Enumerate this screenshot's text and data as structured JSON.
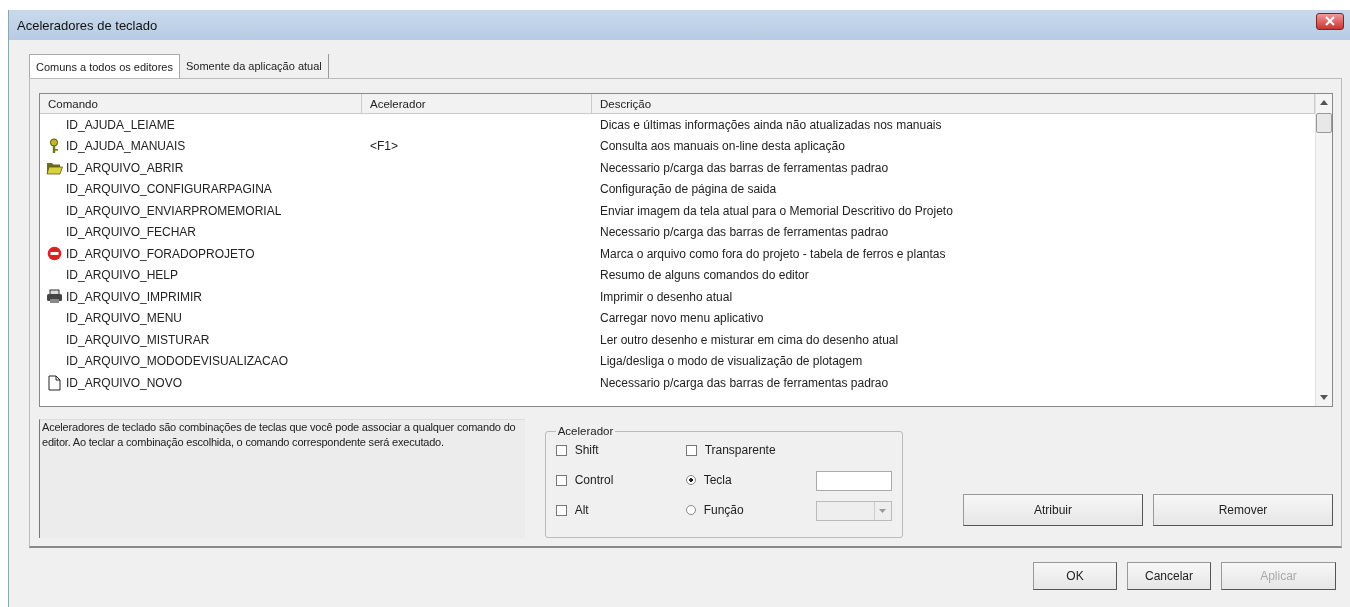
{
  "window": {
    "title": "Aceleradores de teclado"
  },
  "tabs": [
    {
      "label": "Comuns a todos os editores",
      "selected": true
    },
    {
      "label": "Somente da aplicação atual",
      "selected": false
    }
  ],
  "table": {
    "columns": [
      "Comando",
      "Acelerador",
      "Descrição"
    ],
    "rows": [
      {
        "kind": "none",
        "command": "ID_AJUDA_LEIAME",
        "accelerator": "",
        "description": "Dicas e últimas informações ainda não atualizadas nos manuais"
      },
      {
        "kind": "key",
        "command": "ID_AJUDA_MANUAIS",
        "accelerator": "<F1>",
        "description": "Consulta aos manuais on-line desta aplicação"
      },
      {
        "kind": "folder",
        "command": "ID_ARQUIVO_ABRIR",
        "accelerator": "",
        "description": "Necessario p/carga das barras de ferramentas padrao"
      },
      {
        "kind": "none",
        "command": "ID_ARQUIVO_CONFIGURARPAGINA",
        "accelerator": "",
        "description": "Configuração de página de saida"
      },
      {
        "kind": "none",
        "command": "ID_ARQUIVO_ENVIARPROMEMORIAL",
        "accelerator": "",
        "description": "Enviar imagem da tela atual para o Memorial Descritivo do Projeto"
      },
      {
        "kind": "none",
        "command": "ID_ARQUIVO_FECHAR",
        "accelerator": "",
        "description": "Necessario p/carga das barras de ferramentas padrao"
      },
      {
        "kind": "stop",
        "command": "ID_ARQUIVO_FORADOPROJETO",
        "accelerator": "",
        "description": "Marca o arquivo como fora do projeto - tabela de ferros e plantas"
      },
      {
        "kind": "none",
        "command": "ID_ARQUIVO_HELP",
        "accelerator": "",
        "description": "Resumo de alguns comandos do editor"
      },
      {
        "kind": "printer",
        "command": "ID_ARQUIVO_IMPRIMIR",
        "accelerator": "",
        "description": "Imprimir o desenho atual"
      },
      {
        "kind": "none",
        "command": "ID_ARQUIVO_MENU",
        "accelerator": "",
        "description": "Carregar novo menu aplicativo"
      },
      {
        "kind": "none",
        "command": "ID_ARQUIVO_MISTURAR",
        "accelerator": "",
        "description": "Ler outro desenho e misturar em cima do desenho atual"
      },
      {
        "kind": "none",
        "command": "ID_ARQUIVO_MODODEVISUALIZACAO",
        "accelerator": "",
        "description": "Liga/desliga o modo de visualização de plotagem"
      },
      {
        "kind": "document",
        "command": "ID_ARQUIVO_NOVO",
        "accelerator": "",
        "description": "Necessario p/carga das barras de ferramentas padrao"
      }
    ]
  },
  "help_text": "Aceleradores de teclado são combinações de teclas que você pode associar a qualquer comando do editor. Ao teclar a combinação escolhida, o comando correspondente será executado.",
  "accelerator_group": {
    "title": "Acelerador",
    "modifiers": [
      {
        "label": "Shift",
        "checked": false
      },
      {
        "label": "Control",
        "checked": false
      },
      {
        "label": "Alt",
        "checked": false
      }
    ],
    "transparent": {
      "label": "Transparente",
      "checked": false
    },
    "modes": [
      {
        "label": "Tecla",
        "selected": true
      },
      {
        "label": "Função",
        "selected": false
      }
    ]
  },
  "action_buttons": [
    "Atribuir",
    "Remover"
  ],
  "dialog_buttons": [
    {
      "label": "OK",
      "disabled": false
    },
    {
      "label": "Cancelar",
      "disabled": false
    },
    {
      "label": "Aplicar",
      "disabled": true
    }
  ]
}
